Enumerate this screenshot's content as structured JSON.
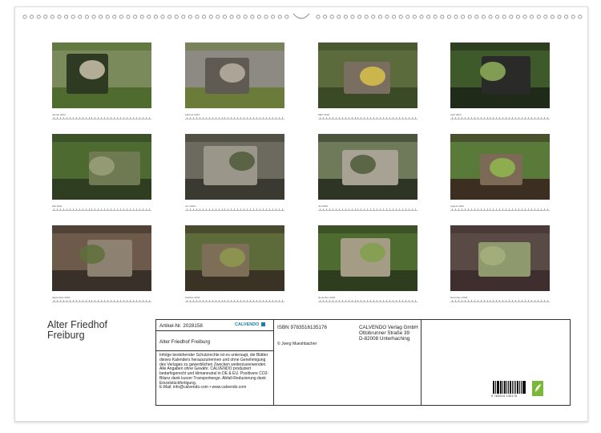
{
  "title": {
    "line1": "Alter Friedhof",
    "line2": "Freiburg"
  },
  "months": [
    {
      "caption": "Januar 2024"
    },
    {
      "caption": "Februar 2024"
    },
    {
      "caption": "März 2024"
    },
    {
      "caption": "April 2024"
    },
    {
      "caption": "Mai 2024"
    },
    {
      "caption": "Juni 2024"
    },
    {
      "caption": "Juli 2024"
    },
    {
      "caption": "August 2024"
    },
    {
      "caption": "September 2024"
    },
    {
      "caption": "Oktober 2024"
    },
    {
      "caption": "November 2024"
    },
    {
      "caption": "Dezember 2024"
    }
  ],
  "info": {
    "article": "Artikel-Nr. 2028158",
    "brand": "CALVENDO",
    "product_title": "Alter Friedhof Freiburg",
    "legal_text": "Infolge bestehender Schutzrechte ist es untersagt, die Blätter dieses Kalenders herauszutrennen und ohne Genehmigung des Verlages zu gewerblichen Zwecken weiterzuverwenden. Alle Angaben ohne Gewähr. CALVENDO produziert bedarfsgerecht und klimaneutral in DE & EU. Positivere CO2-Bilanz dank kurzer Transportwege. Abfall-Reduzierung dank Einzelstückfertigung.",
    "email": "E-Mail: info@calvendo.com • www.calvendo.com",
    "isbn": "ISBN 9783516135176",
    "copyright": "© Joerg Mueshbacher",
    "publisher": [
      "CALVENDO Verlag GmbH",
      "Ottobrunner Straße 39",
      "D-82008 Unterhaching"
    ],
    "barcode_number": "9 783516 135176"
  }
}
